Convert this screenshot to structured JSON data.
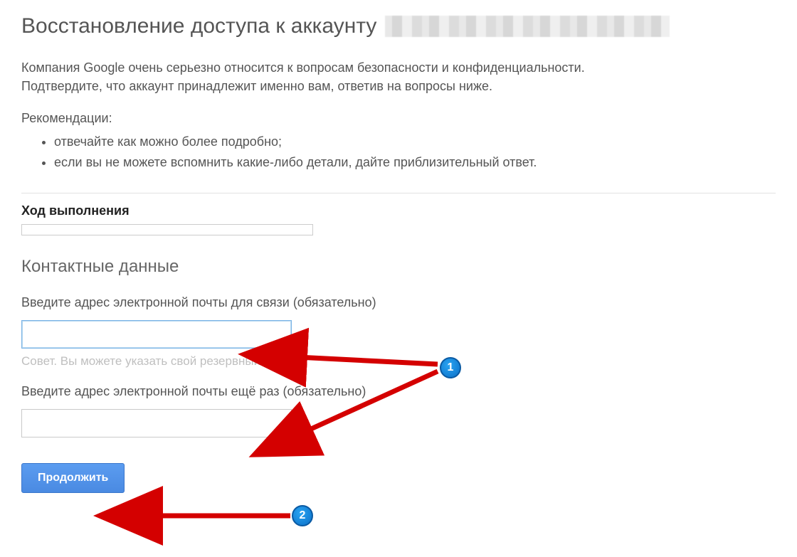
{
  "title": "Восстановление доступа к аккаунту",
  "intro": "Компания Google очень серьезно относится к вопросам безопасности и конфиденциальности. Подтвердите, что аккаунт принадлежит именно вам, ответив на вопросы ниже.",
  "recommendations_label": "Рекомендации:",
  "recommendations": [
    "отвечайте как можно более подробно;",
    "если вы не можете вспомнить какие-либо детали, дайте приблизительный ответ."
  ],
  "progress_label": "Ход выполнения",
  "section_contact": "Контактные данные",
  "field_email_label": "Введите адрес электронной почты для связи (обязательно)",
  "field_email_value": "",
  "field_email_hint": "Совет. Вы можете указать свой резервный адрес.",
  "field_email_confirm_label": "Введите адрес электронной почты ещё раз (обязательно)",
  "field_email_confirm_value": "",
  "continue_label": "Продолжить",
  "annotations": {
    "badge1": "1",
    "badge2": "2"
  }
}
